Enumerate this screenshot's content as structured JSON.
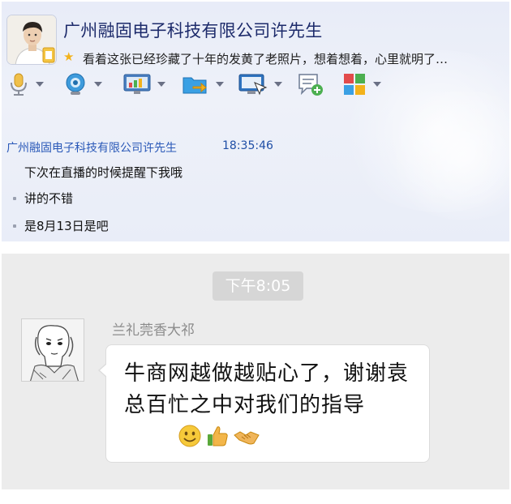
{
  "qq": {
    "contact_name": "广州融固电子科技有限公司许先生",
    "signature": "看着这张已经珍藏了十年的发黄了老照片，想着想着，心里就明了…",
    "toolbar": [
      {
        "icon": "microphone-icon"
      },
      {
        "icon": "video-camera-icon"
      },
      {
        "icon": "screen-share-icon"
      },
      {
        "icon": "send-file-icon"
      },
      {
        "icon": "remote-desktop-icon"
      },
      {
        "icon": "create-discussion-icon"
      },
      {
        "icon": "apps-icon"
      }
    ],
    "message": {
      "sender": "广州融固电子科技有限公司许先生",
      "time": "18:35:46",
      "lines": [
        "下次在直播的时候提醒下我哦",
        "讲的不错",
        "是8月13日是吧"
      ]
    }
  },
  "wechat": {
    "time": "下午8:05",
    "sender": "兰礼莞香大祁",
    "message_text": "牛商网越做越贴心了，谢谢袁总百忙之中对我们的指导",
    "emojis": [
      "smile-emoji",
      "thumbs-up-emoji",
      "handshake-emoji"
    ]
  },
  "colors": {
    "qq_background": "#e8ecf8",
    "qq_sender": "#2a59b8",
    "wechat_background": "#ececec",
    "bubble": "#ffffff"
  }
}
